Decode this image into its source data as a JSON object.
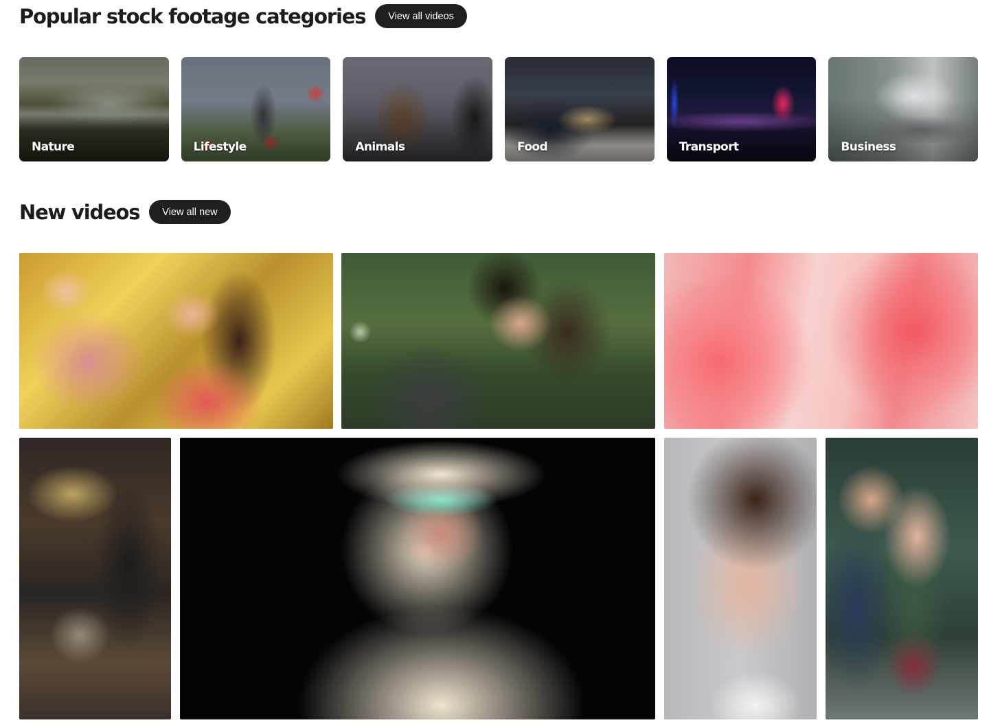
{
  "categories_section": {
    "title": "Popular stock footage categories",
    "button_label": "View all videos",
    "items": [
      {
        "label": "Nature"
      },
      {
        "label": "Lifestyle"
      },
      {
        "label": "Animals"
      },
      {
        "label": "Food"
      },
      {
        "label": "Transport"
      },
      {
        "label": "Business"
      }
    ]
  },
  "new_videos_section": {
    "title": "New videos",
    "button_label": "View all new"
  }
}
